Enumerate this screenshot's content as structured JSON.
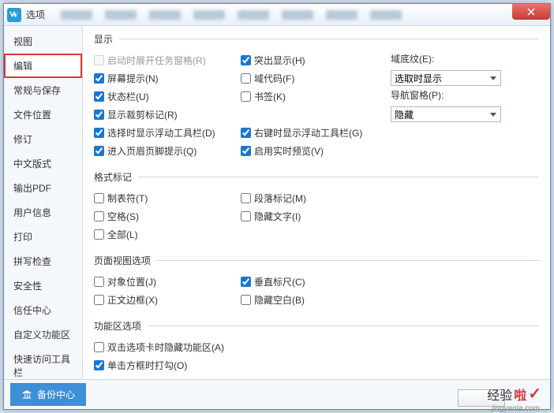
{
  "window": {
    "title": "选项"
  },
  "close": "×",
  "sidebar": {
    "items": [
      {
        "label": "视图"
      },
      {
        "label": "编辑"
      },
      {
        "label": "常规与保存"
      },
      {
        "label": "文件位置"
      },
      {
        "label": "修订"
      },
      {
        "label": "中文版式"
      },
      {
        "label": "输出PDF"
      },
      {
        "label": "用户信息"
      },
      {
        "label": "打印"
      },
      {
        "label": "拼写检查"
      },
      {
        "label": "安全性"
      },
      {
        "label": "信任中心"
      },
      {
        "label": "自定义功能区"
      },
      {
        "label": "快速访问工具栏"
      }
    ]
  },
  "sections": {
    "display": {
      "legend": "显示",
      "startupTaskPane": "启动时展开任务窗格(R)",
      "highlight": "突出显示(H)",
      "fieldShading": "域底纹(E):",
      "fieldShadingValue": "选取时显示",
      "screenTips": "屏幕提示(N)",
      "fieldCodes": "域代码(F)",
      "navPane": "导航窗格(P):",
      "navPaneValue": "隐藏",
      "statusBar": "状态栏(U)",
      "bookmarks": "书签(K)",
      "cropMarks": "显示裁剪标记(R)",
      "floatingToolbar": "选择时显示浮动工具栏(D)",
      "miniToolbarRight": "右键时显示浮动工具栏(G)",
      "headerFooterTip": "进入页眉页脚提示(Q)",
      "livePreview": "启用实时预览(V)"
    },
    "marks": {
      "legend": "格式标记",
      "tabs": "制表符(T)",
      "paragraphMarks": "段落标记(M)",
      "spaces": "空格(S)",
      "hiddenText": "隐藏文字(I)",
      "all": "全部(L)"
    },
    "pageView": {
      "legend": "页面视图选项",
      "objectPos": "对象位置(J)",
      "vRuler": "垂直标尺(C)",
      "textBoundaries": "正文边框(X)",
      "hideWhitespace": "隐藏空白(B)"
    },
    "ribbon": {
      "legend": "功能区选项",
      "hideOnDblClick": "双击选项卡时隐藏功能区(A)",
      "checkOnClick": "单击方框时打勾(O)"
    }
  },
  "footer": {
    "backup": "备份中心"
  },
  "watermark": {
    "main1": "经验",
    "main2": "啦",
    "sub": "jingyanla.com"
  }
}
